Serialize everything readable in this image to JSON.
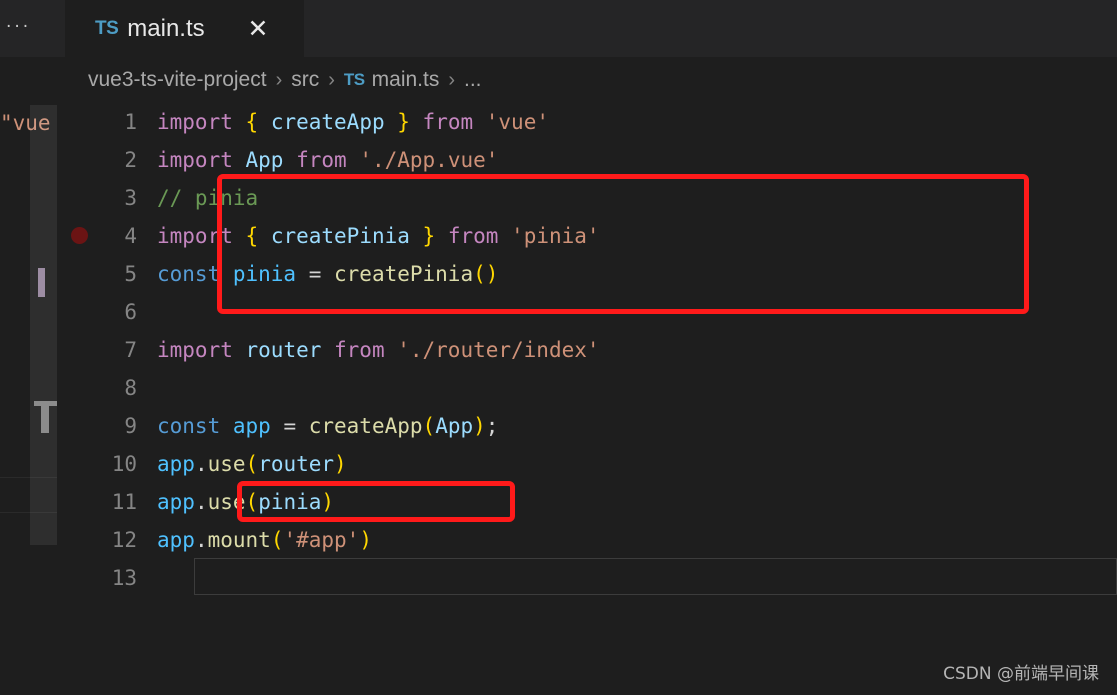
{
  "window": {
    "background": "#1e1e1e",
    "tabbar_background": "#252526"
  },
  "left_panel": {
    "ellipsis": "...",
    "code_fragment": "\"vue",
    "minimap_name": "minimap"
  },
  "tab": {
    "file_icon_label": "TS",
    "title": "main.ts",
    "close_label": "✕"
  },
  "breadcrumb": {
    "project": "vue3-ts-vite-project",
    "folder": "src",
    "file_icon_label": "TS",
    "file": "main.ts",
    "more": "...",
    "separator": "›"
  },
  "editor": {
    "language": "typescript",
    "line_numbers": [
      "1",
      "2",
      "3",
      "4",
      "5",
      "6",
      "7",
      "8",
      "9",
      "10",
      "11",
      "12",
      "13"
    ],
    "current_line": 13,
    "breakpoint_line": 4,
    "lines": [
      {
        "number": "1",
        "tokens": [
          {
            "text": "import ",
            "type": "keyword"
          },
          {
            "text": "{ ",
            "type": "brace"
          },
          {
            "text": "createApp",
            "type": "identifier"
          },
          {
            "text": " }",
            "type": "brace"
          },
          {
            "text": " from ",
            "type": "keyword"
          },
          {
            "text": "'vue'",
            "type": "string"
          }
        ]
      },
      {
        "number": "2",
        "tokens": [
          {
            "text": "import ",
            "type": "keyword"
          },
          {
            "text": "App",
            "type": "identifier"
          },
          {
            "text": " from ",
            "type": "keyword"
          },
          {
            "text": "'./App.vue'",
            "type": "string"
          }
        ]
      },
      {
        "number": "3",
        "tokens": [
          {
            "text": "// pinia",
            "type": "comment"
          }
        ]
      },
      {
        "number": "4",
        "tokens": [
          {
            "text": "import ",
            "type": "keyword"
          },
          {
            "text": "{ ",
            "type": "brace"
          },
          {
            "text": "createPinia",
            "type": "identifier"
          },
          {
            "text": " }",
            "type": "brace"
          },
          {
            "text": " from ",
            "type": "keyword"
          },
          {
            "text": "'pinia'",
            "type": "string"
          }
        ]
      },
      {
        "number": "5",
        "tokens": [
          {
            "text": "const ",
            "type": "control"
          },
          {
            "text": "pinia",
            "type": "variable"
          },
          {
            "text": " = ",
            "type": "plain"
          },
          {
            "text": "createPinia",
            "type": "function"
          },
          {
            "text": "()",
            "type": "brace"
          }
        ]
      },
      {
        "number": "6",
        "tokens": []
      },
      {
        "number": "7",
        "tokens": [
          {
            "text": "import ",
            "type": "keyword"
          },
          {
            "text": "router",
            "type": "identifier"
          },
          {
            "text": " from ",
            "type": "keyword"
          },
          {
            "text": "'./router/index'",
            "type": "string"
          }
        ]
      },
      {
        "number": "8",
        "tokens": []
      },
      {
        "number": "9",
        "tokens": [
          {
            "text": "const ",
            "type": "control"
          },
          {
            "text": "app",
            "type": "variable"
          },
          {
            "text": " = ",
            "type": "plain"
          },
          {
            "text": "createApp",
            "type": "function"
          },
          {
            "text": "(",
            "type": "brace"
          },
          {
            "text": "App",
            "type": "identifier"
          },
          {
            "text": ")",
            "type": "brace"
          },
          {
            "text": ";",
            "type": "plain"
          }
        ]
      },
      {
        "number": "10",
        "tokens": [
          {
            "text": "app",
            "type": "variable"
          },
          {
            "text": ".",
            "type": "plain"
          },
          {
            "text": "use",
            "type": "function"
          },
          {
            "text": "(",
            "type": "brace"
          },
          {
            "text": "router",
            "type": "identifier"
          },
          {
            "text": ")",
            "type": "brace"
          }
        ]
      },
      {
        "number": "11",
        "tokens": [
          {
            "text": "app",
            "type": "variable"
          },
          {
            "text": ".",
            "type": "plain"
          },
          {
            "text": "use",
            "type": "function"
          },
          {
            "text": "(",
            "type": "brace"
          },
          {
            "text": "pinia",
            "type": "identifier"
          },
          {
            "text": ")",
            "type": "brace"
          }
        ]
      },
      {
        "number": "12",
        "tokens": [
          {
            "text": "app",
            "type": "variable"
          },
          {
            "text": ".",
            "type": "plain"
          },
          {
            "text": "mount",
            "type": "function"
          },
          {
            "text": "(",
            "type": "brace"
          },
          {
            "text": "'#app'",
            "type": "string"
          },
          {
            "text": ")",
            "type": "brace"
          }
        ]
      },
      {
        "number": "13",
        "tokens": []
      }
    ]
  },
  "annotations": {
    "color": "#ff1a1a",
    "boxes": [
      {
        "name": "pinia-import-block",
        "lines": "3-5"
      },
      {
        "name": "pinia-use-line",
        "lines": "11"
      }
    ]
  },
  "watermark": {
    "text": "CSDN @前端早间课"
  }
}
